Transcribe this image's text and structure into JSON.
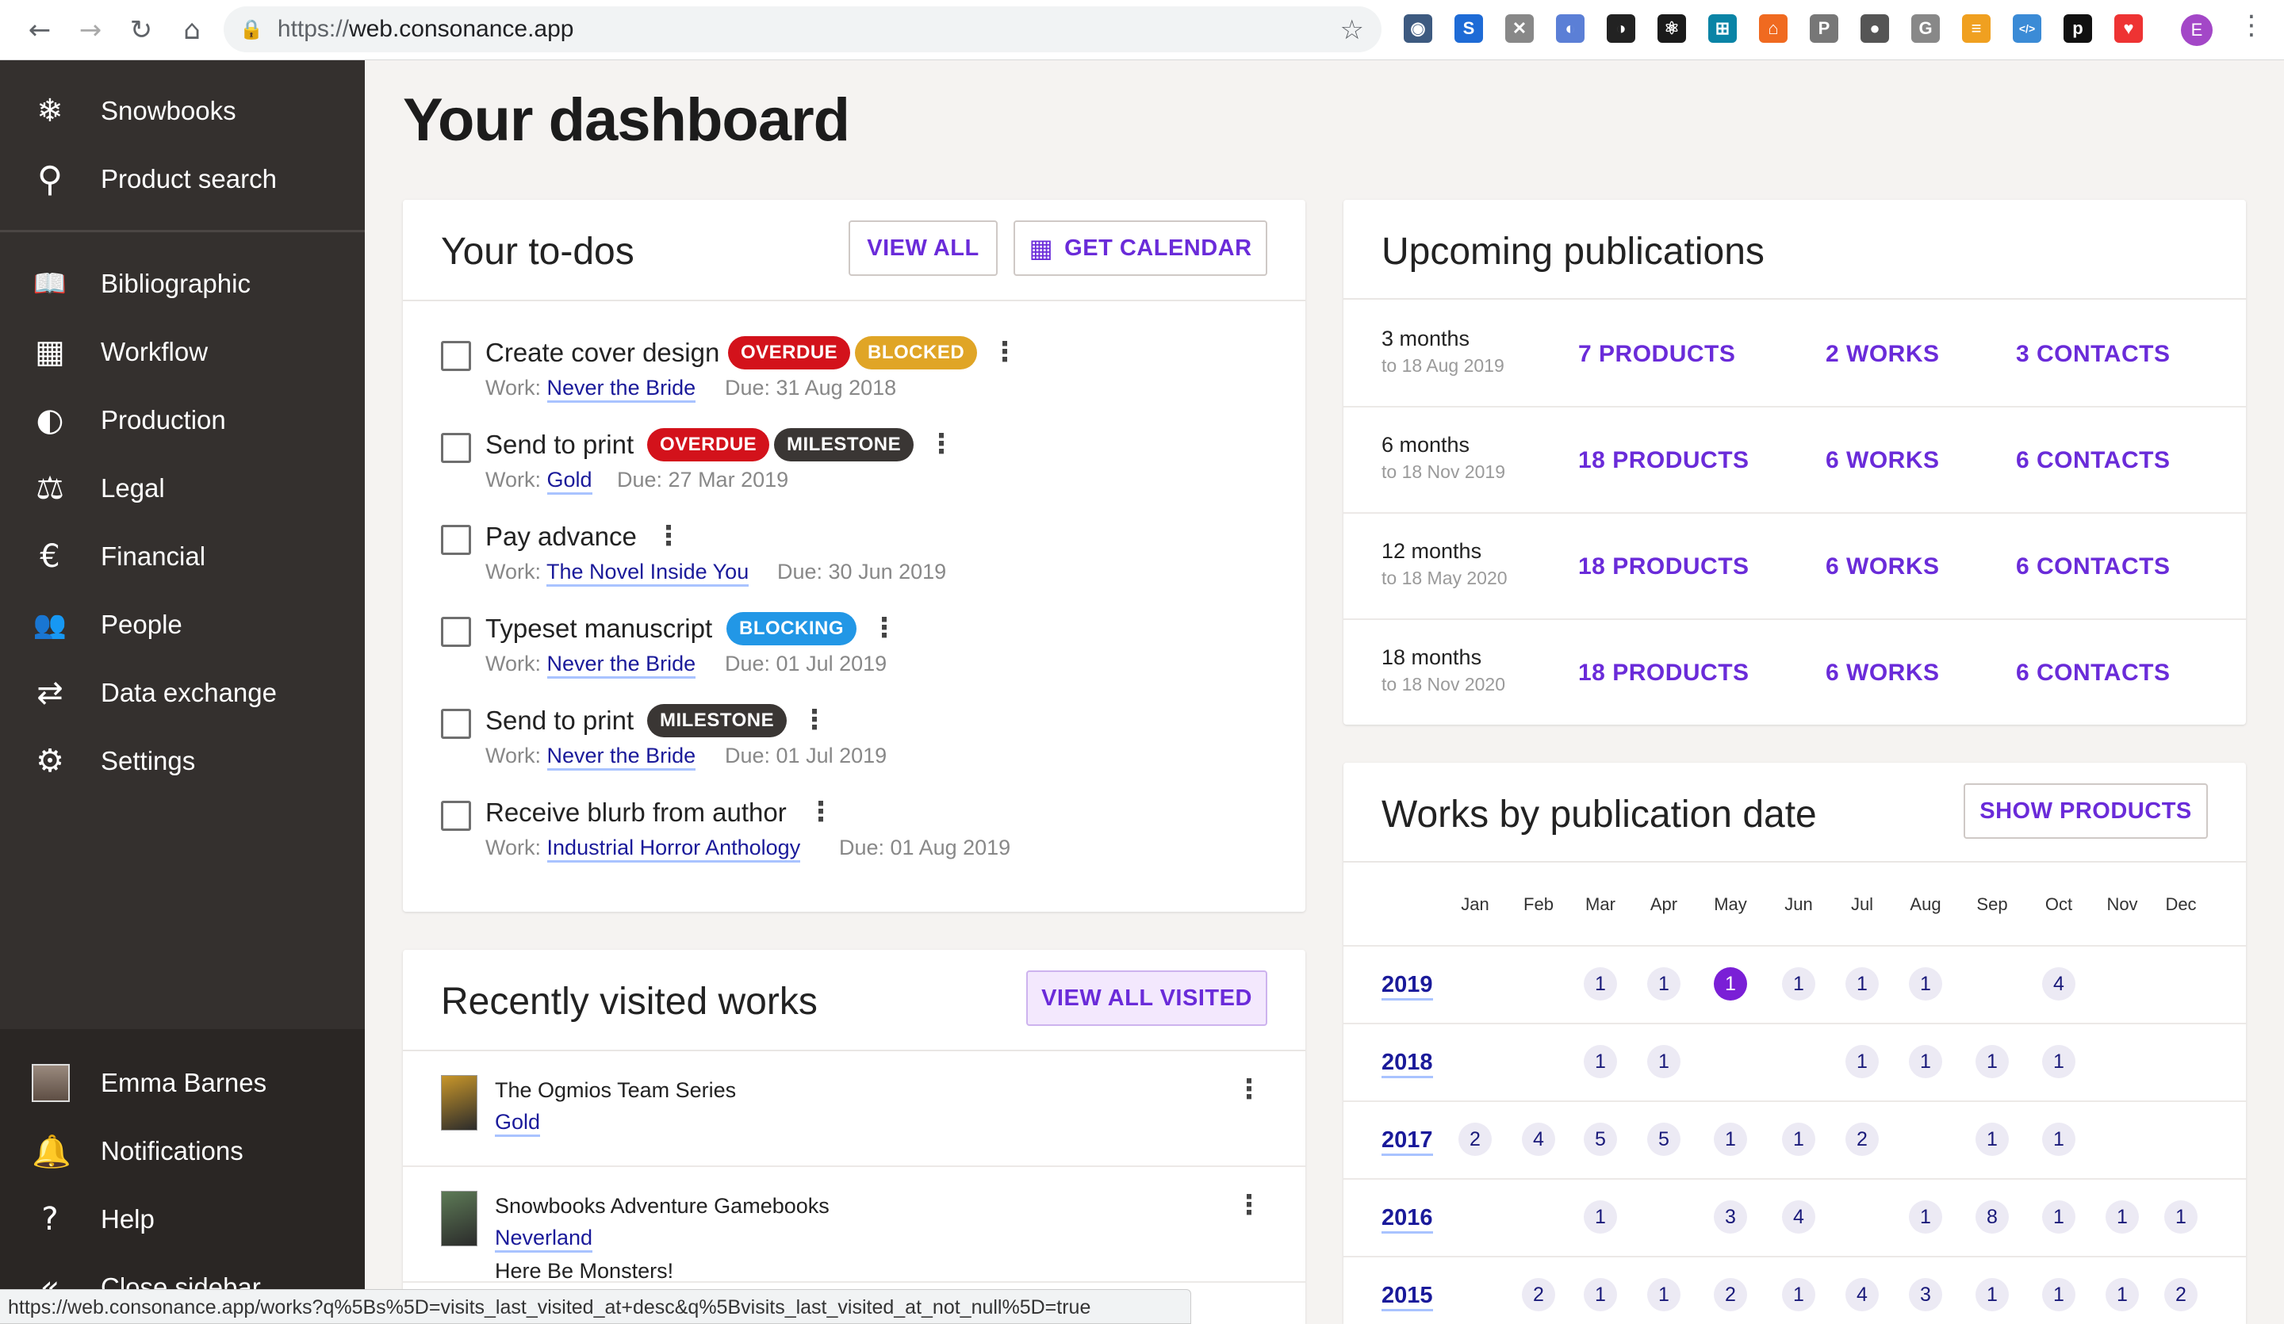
{
  "browser": {
    "url_prefix": "https://",
    "url_host": "web.consonance.app",
    "status_url": "https://web.consonance.app/works?q%5Bs%5D=visits_last_visited_at+desc&q%5Bvisits_last_visited_at_not_null%5D=true",
    "profile_initial": "E",
    "extensions": [
      {
        "name": "lastpass-ext-icon",
        "color": "#3d5a80",
        "glyph": "◉"
      },
      {
        "name": "s-ext-icon",
        "color": "#1e6bd6",
        "glyph": "S"
      },
      {
        "name": "x-ext-icon",
        "color": "#888",
        "glyph": "✕"
      },
      {
        "name": "blue-circle-ext-icon",
        "color": "#5b7fd6",
        "glyph": "◐"
      },
      {
        "name": "dark-mode-ext-icon",
        "color": "#222",
        "glyph": "◑"
      },
      {
        "name": "react-ext-icon",
        "color": "#1b1b1b",
        "glyph": "⚛"
      },
      {
        "name": "cyan-ext-icon",
        "color": "#0a84a6",
        "glyph": "⊞"
      },
      {
        "name": "orange-lock-ext-icon",
        "color": "#f06a20",
        "glyph": "⌂"
      },
      {
        "name": "p-ext-icon",
        "color": "#777",
        "glyph": "P"
      },
      {
        "name": "round-ext-icon",
        "color": "#555",
        "glyph": "●"
      },
      {
        "name": "g-ext-icon",
        "color": "#888",
        "glyph": "G"
      },
      {
        "name": "stack-ext-icon",
        "color": "#f0a020",
        "glyph": "≡"
      },
      {
        "name": "code-ext-icon",
        "color": "#3b8bd6",
        "glyph": "</>"
      },
      {
        "name": "pocket-p-ext-icon",
        "color": "#111",
        "glyph": "p"
      },
      {
        "name": "shield-ext-icon",
        "color": "#e33",
        "glyph": "♥"
      }
    ]
  },
  "sidebar": {
    "top": [
      {
        "name": "snowbooks",
        "label": "Snowbooks",
        "icon": "❄"
      },
      {
        "name": "product-search",
        "label": "Product search",
        "icon": "⚲"
      }
    ],
    "items": [
      {
        "name": "bibliographic",
        "label": "Bibliographic",
        "icon": "📖"
      },
      {
        "name": "workflow",
        "label": "Workflow",
        "icon": "▦"
      },
      {
        "name": "production",
        "label": "Production",
        "icon": "◐"
      },
      {
        "name": "legal",
        "label": "Legal",
        "icon": "⚖"
      },
      {
        "name": "financial",
        "label": "Financial",
        "icon": "€"
      },
      {
        "name": "people",
        "label": "People",
        "icon": "👥"
      },
      {
        "name": "data-exchange",
        "label": "Data exchange",
        "icon": "⇄"
      },
      {
        "name": "settings",
        "label": "Settings",
        "icon": "⚙"
      }
    ],
    "user": "Emma Barnes",
    "notifications": "Notifications",
    "help": "Help",
    "close": "Close sidebar"
  },
  "page": {
    "title": "Your dashboard"
  },
  "todos": {
    "title": "Your to-dos",
    "view_all": "VIEW ALL",
    "get_calendar": "GET CALENDAR",
    "work_prefix": "Work:",
    "items": [
      {
        "title": "Create cover design",
        "badges": [
          "OVERDUE",
          "BLOCKED"
        ],
        "work": "Never the Bride",
        "due": "Due: 31 Aug 2018"
      },
      {
        "title": "Send to print",
        "badges": [
          "OVERDUE",
          "MILESTONE"
        ],
        "work": "Gold",
        "due": "Due: 27 Mar 2019"
      },
      {
        "title": "Pay advance",
        "badges": [],
        "work": "The Novel Inside You",
        "due": "Due: 30 Jun 2019"
      },
      {
        "title": "Typeset manuscript",
        "badges": [
          "BLOCKING"
        ],
        "work": "Never the Bride",
        "due": "Due: 01 Jul 2019"
      },
      {
        "title": "Send to print",
        "badges": [
          "MILESTONE"
        ],
        "work": "Never the Bride",
        "due": "Due: 01 Jul 2019"
      },
      {
        "title": "Receive blurb from author",
        "badges": [],
        "work": "Industrial Horror Anthology",
        "due": "Due: 01 Aug 2019"
      }
    ]
  },
  "upcoming": {
    "title": "Upcoming publications",
    "rows": [
      {
        "period": "3 months",
        "to": "to 18 Aug 2019",
        "products": "7 PRODUCTS",
        "works": "2 WORKS",
        "contacts": "3 CONTACTS"
      },
      {
        "period": "6 months",
        "to": "to 18 Nov 2019",
        "products": "18 PRODUCTS",
        "works": "6 WORKS",
        "contacts": "6 CONTACTS"
      },
      {
        "period": "12 months",
        "to": "to 18 May 2020",
        "products": "18 PRODUCTS",
        "works": "6 WORKS",
        "contacts": "6 CONTACTS"
      },
      {
        "period": "18 months",
        "to": "to 18 Nov 2020",
        "products": "18 PRODUCTS",
        "works": "6 WORKS",
        "contacts": "6 CONTACTS"
      }
    ]
  },
  "works_by_date": {
    "title": "Works by publication date",
    "show_products": "SHOW PRODUCTS",
    "months": [
      "Jan",
      "Feb",
      "Mar",
      "Apr",
      "May",
      "Jun",
      "Jul",
      "Aug",
      "Sep",
      "Oct",
      "Nov",
      "Dec"
    ],
    "rows": [
      {
        "year": "2019",
        "counts": [
          null,
          null,
          1,
          1,
          1,
          1,
          1,
          1,
          null,
          4,
          null,
          null
        ],
        "highlight": 4
      },
      {
        "year": "2018",
        "counts": [
          null,
          null,
          1,
          1,
          null,
          null,
          1,
          1,
          1,
          1,
          null,
          null
        ]
      },
      {
        "year": "2017",
        "counts": [
          2,
          4,
          5,
          5,
          1,
          1,
          2,
          null,
          1,
          1,
          null,
          null
        ]
      },
      {
        "year": "2016",
        "counts": [
          null,
          null,
          1,
          null,
          3,
          4,
          null,
          1,
          8,
          1,
          1,
          1
        ]
      },
      {
        "year": "2015",
        "counts": [
          null,
          2,
          1,
          1,
          2,
          1,
          4,
          3,
          1,
          1,
          1,
          2
        ]
      }
    ]
  },
  "recent": {
    "title": "Recently visited works",
    "view_all": "VIEW ALL VISITED",
    "items": [
      {
        "series": "The Ogmios Team Series",
        "work": "Gold",
        "extra": "",
        "cover_color": "#c8962a"
      },
      {
        "series": "Snowbooks Adventure Gamebooks",
        "work": "Neverland",
        "extra": "Here Be Monsters!",
        "cover_color": "#5d7a56"
      }
    ]
  }
}
